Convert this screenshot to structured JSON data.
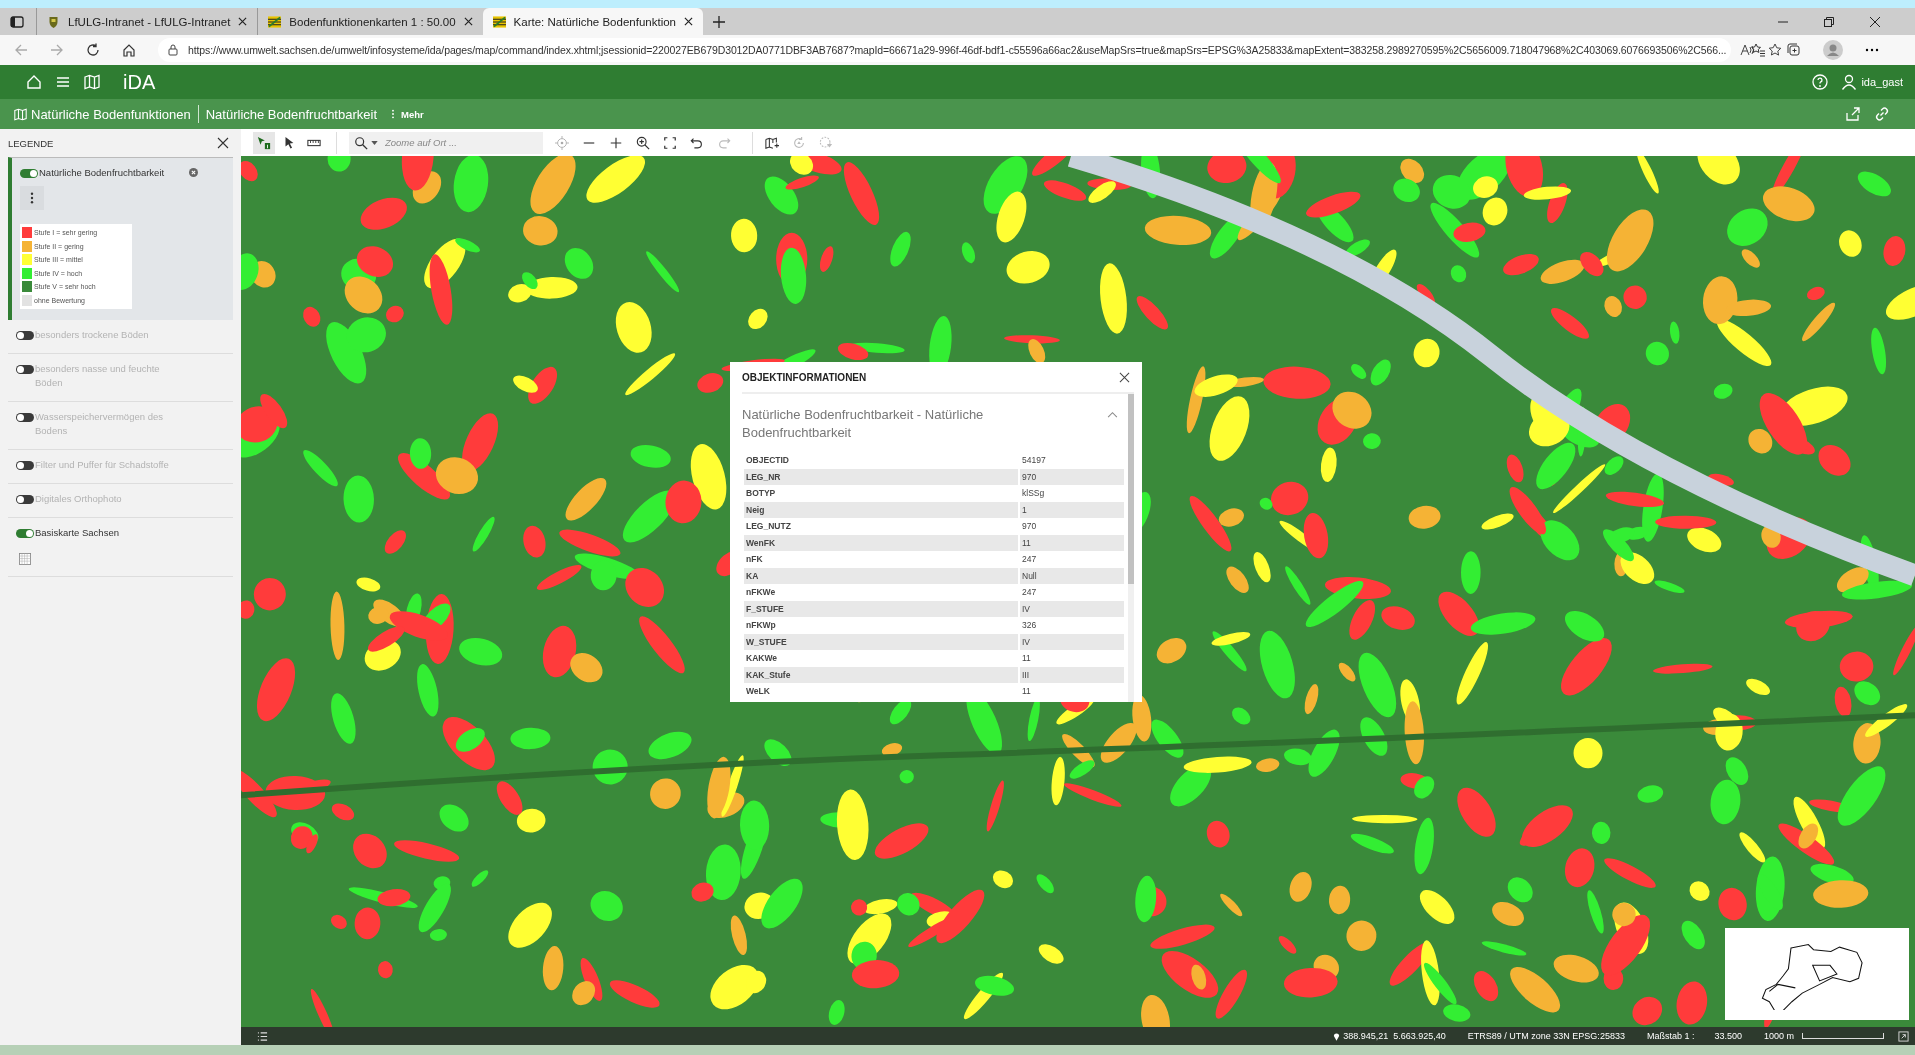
{
  "browser": {
    "tabs": [
      {
        "title": "LfULG-Intranet - LfULG-Intranet",
        "selected": false,
        "kind": "shield"
      },
      {
        "title": "Bodenfunktionenkarten 1 : 50.00",
        "selected": false,
        "kind": "crest"
      },
      {
        "title": "Karte: Natürliche Bodenfunktion",
        "selected": true,
        "kind": "crest"
      }
    ],
    "url": "https://www.umwelt.sachsen.de/umwelt/infosysteme/ida/pages/map/command/index.xhtml;jsessionid=220027EB679D3012DA0771DBF3AB7687?mapId=66671a29-996f-46df-bdf1-c55596a66ac2&useMapSrs=true&mapSrs=EPSG%3A25833&mapExtent=383258.2989270595%2C5656009.718047968%2C403069.6076693506%2C566..."
  },
  "app_header": {
    "title": "iDA",
    "user": "ida_gast"
  },
  "breadcrumb": {
    "items": [
      "Natürliche Bodenfunktionen",
      "Natürliche Bodenfruchtbarkeit"
    ],
    "more": "Mehr"
  },
  "toolbar": {
    "search": {
      "placeholder": "Zoome auf Ort ..."
    }
  },
  "legend": {
    "title": "LEGENDE",
    "layers": [
      {
        "name": "Natürliche Bodenfruchtbarkeit",
        "on": true,
        "selected": true,
        "kind": "legend",
        "entries": [
          {
            "label": "Stufe I = sehr gering",
            "color": "#ff3b3b"
          },
          {
            "label": "Stufe II = gering",
            "color": "#f5b335"
          },
          {
            "label": "Stufe III = mittel",
            "color": "#ffff33"
          },
          {
            "label": "Stufe IV = hoch",
            "color": "#33ee33"
          },
          {
            "label": "Stufe V = sehr hoch",
            "color": "#3a8a3a"
          },
          {
            "label": "ohne Bewertung",
            "color": "#e2e2e2"
          }
        ]
      },
      {
        "name": "besonders trockene Böden",
        "on": false,
        "selected": false,
        "kind": "plain"
      },
      {
        "name": "besonders nasse und feuchte Böden",
        "on": false,
        "selected": false,
        "kind": "plain"
      },
      {
        "name": "Wasserspeichervermögen des Bodens",
        "on": false,
        "selected": false,
        "kind": "plain"
      },
      {
        "name": "Filter und Puffer für Schadstoffe",
        "on": false,
        "selected": false,
        "kind": "plain"
      },
      {
        "name": "Digitales Orthophoto",
        "on": false,
        "selected": false,
        "kind": "plain"
      },
      {
        "name": "Basiskarte Sachsen",
        "on": true,
        "selected": false,
        "kind": "base"
      }
    ]
  },
  "popup": {
    "title": "OBJEKTINFORMATIONEN",
    "section": "Natürliche Bodenfruchtbarkeit - Natürliche Bodenfruchtbarkeit",
    "expanded": true,
    "rows": [
      {
        "key": "OBJECTID",
        "value": "54197"
      },
      {
        "key": "LEG_NR",
        "value": "970"
      },
      {
        "key": "BOTYP",
        "value": "klSSg"
      },
      {
        "key": "Neig",
        "value": "1"
      },
      {
        "key": "LEG_NUTZ",
        "value": "970"
      },
      {
        "key": "WenFK",
        "value": "11"
      },
      {
        "key": "nFK",
        "value": "247"
      },
      {
        "key": "KA",
        "value": "Null"
      },
      {
        "key": "nFKWe",
        "value": "247"
      },
      {
        "key": "F_STUFE",
        "value": "IV"
      },
      {
        "key": "nFKWp",
        "value": "326"
      },
      {
        "key": "W_STUFE",
        "value": "IV"
      },
      {
        "key": "KAKWe",
        "value": "11"
      },
      {
        "key": "KAK_Stufe",
        "value": "III"
      },
      {
        "key": "WeLK",
        "value": "11"
      }
    ]
  },
  "status_bar": {
    "coordinates": "388.945,21  5.663.925,40",
    "crs": "ETRS89 / UTM zone 33N EPSG:25833",
    "scale_label": "Maßstab 1 :",
    "scale_value": "33.500",
    "scale_bar": "1000 m"
  }
}
